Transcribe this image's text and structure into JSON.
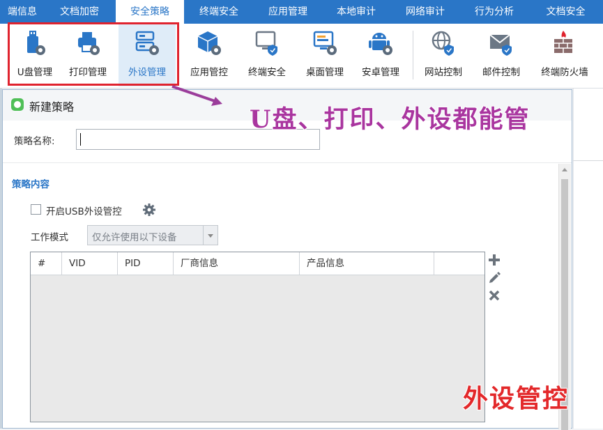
{
  "tabs": [
    "端信息",
    "文档加密",
    "安全策略",
    "终端安全",
    "应用管理",
    "本地审计",
    "网络审计",
    "行为分析",
    "文档安全"
  ],
  "active_tab": "安全策略",
  "ribbon": {
    "items": [
      {
        "label": "U盘管理",
        "icon": "usb-gear-icon"
      },
      {
        "label": "打印管理",
        "icon": "printer-gear-icon"
      },
      {
        "label": "外设管理",
        "icon": "peripheral-gear-icon",
        "selected": true
      },
      {
        "label": "应用管控",
        "icon": "cube-gear-icon"
      },
      {
        "label": "终端安全",
        "icon": "monitor-shield-icon"
      },
      {
        "label": "桌面管理",
        "icon": "desktop-gear-icon"
      },
      {
        "label": "安卓管理",
        "icon": "android-gear-icon"
      },
      {
        "label": "网站控制",
        "icon": "globe-shield-icon"
      },
      {
        "label": "邮件控制",
        "icon": "mail-shield-icon"
      },
      {
        "label": "终端防火墙",
        "icon": "firewall-icon"
      }
    ]
  },
  "dialog": {
    "title": "新建策略",
    "name_label": "策略名称:",
    "name_value": "",
    "section_title": "策略内容",
    "usb_toggle_label": "开启USB外设管控",
    "usb_toggle_checked": false,
    "mode_label": "工作模式",
    "mode_value": "仅允许使用以下设备",
    "columns": [
      "#",
      "VID",
      "PID",
      "厂商信息",
      "产品信息"
    ],
    "rows": []
  },
  "annotations": {
    "top": "U盘、打印、外设都能管",
    "bottom": "外设管控"
  },
  "colors": {
    "tab_bar": "#2a76c7",
    "highlight_box": "#e0232e",
    "annotation_top": "#a9359f",
    "annotation_bottom": "#e3282a",
    "section_title": "#2a76c7"
  }
}
